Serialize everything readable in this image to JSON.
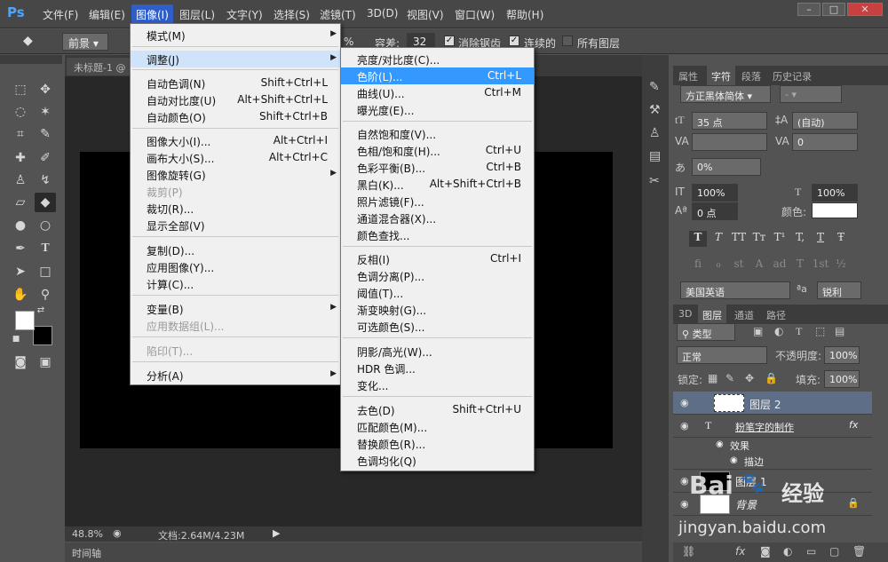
{
  "menubar": {
    "logo": "Ps",
    "items": [
      "文件(F)",
      "编辑(E)",
      "图像(I)",
      "图层(L)",
      "文字(Y)",
      "选择(S)",
      "滤镜(T)",
      "3D(D)",
      "视图(V)",
      "窗口(W)",
      "帮助(H)"
    ],
    "active_item": "图像(I)",
    "window_buttons": [
      "–",
      "□",
      "✕"
    ]
  },
  "options_bar": {
    "fill_source": "前景",
    "tolerance_label": "容差:",
    "tolerance_value": "32",
    "antialias_label": "消除锯齿",
    "contiguous_label": "连续的",
    "all_layers_label": "所有图层",
    "partial_value": "%"
  },
  "document": {
    "tab_title": "未标题-1 @",
    "zoom": "48.8%",
    "doc_info": "文档:2.64M/4.23M",
    "timeline_label": "时间轴"
  },
  "image_menu": {
    "items": [
      {
        "label": "模式(M)",
        "shortcut": "",
        "submenu": true,
        "disabled": false
      },
      {
        "label": "调整(J)",
        "shortcut": "",
        "submenu": true,
        "disabled": false,
        "highlight": true
      },
      {
        "label": "自动色调(N)",
        "shortcut": "Shift+Ctrl+L",
        "disabled": false
      },
      {
        "label": "自动对比度(U)",
        "shortcut": "Alt+Shift+Ctrl+L",
        "disabled": false
      },
      {
        "label": "自动颜色(O)",
        "shortcut": "Shift+Ctrl+B",
        "disabled": false
      },
      {
        "label": "图像大小(I)...",
        "shortcut": "Alt+Ctrl+I",
        "disabled": false
      },
      {
        "label": "画布大小(S)...",
        "shortcut": "Alt+Ctrl+C",
        "disabled": false
      },
      {
        "label": "图像旋转(G)",
        "shortcut": "",
        "submenu": true,
        "disabled": false
      },
      {
        "label": "裁剪(P)",
        "shortcut": "",
        "disabled": true
      },
      {
        "label": "裁切(R)...",
        "shortcut": "",
        "disabled": false
      },
      {
        "label": "显示全部(V)",
        "shortcut": "",
        "disabled": false
      },
      {
        "label": "复制(D)...",
        "shortcut": "",
        "disabled": false
      },
      {
        "label": "应用图像(Y)...",
        "shortcut": "",
        "disabled": false
      },
      {
        "label": "计算(C)...",
        "shortcut": "",
        "disabled": false
      },
      {
        "label": "变量(B)",
        "shortcut": "",
        "submenu": true,
        "disabled": false
      },
      {
        "label": "应用数据组(L)...",
        "shortcut": "",
        "disabled": true
      },
      {
        "label": "陷印(T)...",
        "shortcut": "",
        "disabled": true
      },
      {
        "label": "分析(A)",
        "shortcut": "",
        "submenu": true,
        "disabled": false
      }
    ]
  },
  "adjust_menu": {
    "items": [
      {
        "label": "亮度/对比度(C)...",
        "shortcut": ""
      },
      {
        "label": "色阶(L)...",
        "shortcut": "Ctrl+L",
        "highlight": true
      },
      {
        "label": "曲线(U)...",
        "shortcut": "Ctrl+M"
      },
      {
        "label": "曝光度(E)...",
        "shortcut": ""
      },
      {
        "label": "自然饱和度(V)...",
        "shortcut": ""
      },
      {
        "label": "色相/饱和度(H)...",
        "shortcut": "Ctrl+U"
      },
      {
        "label": "色彩平衡(B)...",
        "shortcut": "Ctrl+B"
      },
      {
        "label": "黑白(K)...",
        "shortcut": "Alt+Shift+Ctrl+B"
      },
      {
        "label": "照片滤镜(F)...",
        "shortcut": ""
      },
      {
        "label": "通道混合器(X)...",
        "shortcut": ""
      },
      {
        "label": "颜色查找...",
        "shortcut": ""
      },
      {
        "label": "反相(I)",
        "shortcut": "Ctrl+I"
      },
      {
        "label": "色调分离(P)...",
        "shortcut": ""
      },
      {
        "label": "阈值(T)...",
        "shortcut": ""
      },
      {
        "label": "渐变映射(G)...",
        "shortcut": ""
      },
      {
        "label": "可选颜色(S)...",
        "shortcut": ""
      },
      {
        "label": "阴影/高光(W)...",
        "shortcut": ""
      },
      {
        "label": "HDR 色调...",
        "shortcut": ""
      },
      {
        "label": "变化...",
        "shortcut": ""
      },
      {
        "label": "去色(D)",
        "shortcut": "Shift+Ctrl+U"
      },
      {
        "label": "匹配颜色(M)...",
        "shortcut": ""
      },
      {
        "label": "替换颜色(R)...",
        "shortcut": ""
      },
      {
        "label": "色调均化(Q)",
        "shortcut": ""
      }
    ]
  },
  "character_panel": {
    "tabs": [
      "属性",
      "字符",
      "段落",
      "历史记录"
    ],
    "active_tab": "字符",
    "font_family": "方正黑体简体",
    "font_style": "-",
    "font_size": "35 点",
    "leading": "(自动)",
    "tracking": "0",
    "scale_percent": "0%",
    "vertical_scale": "100%",
    "horizontal_scale": "100%",
    "baseline_shift": "0 点",
    "color_label": "颜色:",
    "style_buttons": [
      "T",
      "T",
      "TT",
      "Tт",
      "T¹",
      "T,",
      "T",
      "Ŧ"
    ],
    "opentype_buttons": [
      "fi",
      "ℴ",
      "st",
      "A",
      "ad",
      "T",
      "1st",
      "½"
    ],
    "language": "美国英语",
    "aa_label": "ªa",
    "antialias": "锐利"
  },
  "layers_panel": {
    "tabs": [
      "3D",
      "图层",
      "通道",
      "路径"
    ],
    "active_tab": "图层",
    "filter_kind": "类型",
    "blend_mode": "正常",
    "opacity_label": "不透明度:",
    "opacity": "100%",
    "lock_label": "锁定:",
    "fill_label": "填充:",
    "fill": "100%",
    "layers": [
      {
        "name": "图层 2",
        "selected": true
      },
      {
        "name": "粉笔字的制作",
        "type": "text"
      },
      {
        "name": "效果",
        "sub": true
      },
      {
        "name": "描边",
        "sub": true
      },
      {
        "name": "图层 1"
      },
      {
        "name": "背景"
      }
    ],
    "fx_label": "fx"
  },
  "watermark": {
    "brand": "Bai",
    "brand_cn": "经验",
    "url": "jingyan.baidu.com"
  }
}
